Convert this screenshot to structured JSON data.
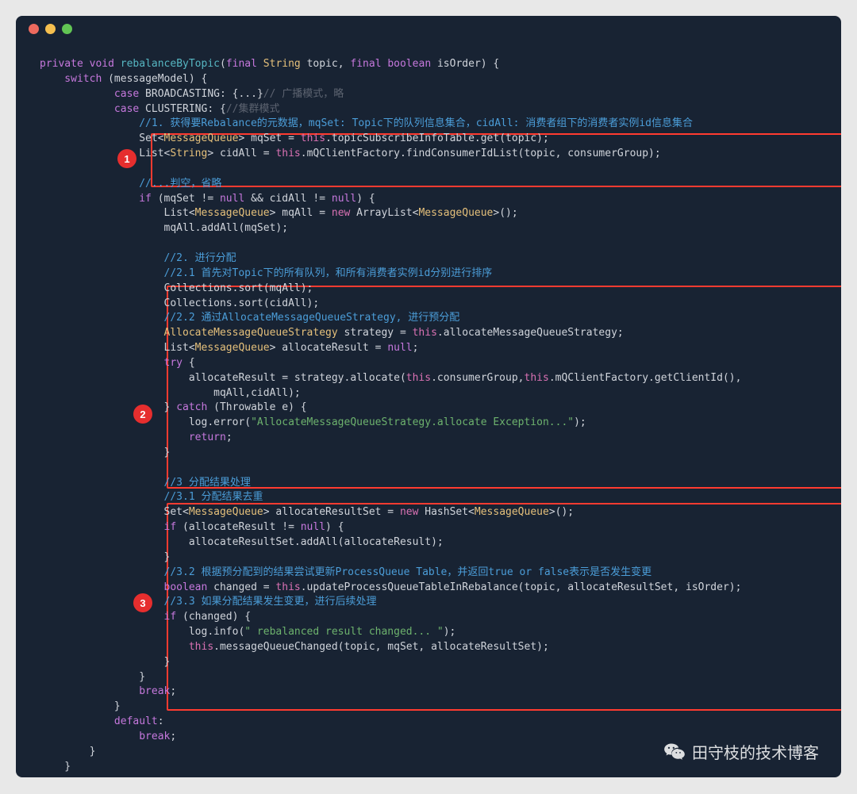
{
  "titlebar": {
    "dots": [
      "red",
      "yellow",
      "green"
    ]
  },
  "badges": [
    "1",
    "2",
    "3"
  ],
  "watermark": "田守枝的技术博客",
  "code": {
    "l01_private": "private",
    "l01_void": "void",
    "l01_fn": "rebalanceByTopic",
    "l01_p1": "(",
    "l01_final1": "final",
    "l01_type1": "String",
    "l01_arg1": " topic, ",
    "l01_final2": "final",
    "l01_boolean": "boolean",
    "l01_arg2": " isOrder) {",
    "l02_switch": "    switch",
    "l02_rest": " (messageModel) {",
    "l03_case": "            case",
    "l03_broad": " BROADCASTING: {...}",
    "l03_cmt": "// 广播模式，略",
    "l04_case": "            case",
    "l04_clust": " CLUSTERING: {",
    "l04_cmt": "//集群模式",
    "l05_cmt": "                //1. 获得要Rebalance的元数据，mqSet: Topic下的队列信息集合，cidAll: 消费者组下的消费者实例id信息集合",
    "l06_set": "                Set<",
    "l06_mq": "MessageQueue",
    "l06_var": "> mqSet = ",
    "l06_this": "this",
    "l06_rest": ".topicSubscribeInfoTable.get(topic);",
    "l07_list": "                List<",
    "l07_str": "String",
    "l07_var": "> cidAll = ",
    "l07_this": "this",
    "l07_rest": ".mQClientFactory.findConsumerIdList(topic, consumerGroup);",
    "l08": "",
    "l09_cmt": "                //...判空，省略",
    "l10_if": "                if",
    "l10_rest": " (mqSet != ",
    "l10_null1": "null",
    "l10_and": " && cidAll != ",
    "l10_null2": "null",
    "l10_brace": ") {",
    "l11_list": "                    List<",
    "l11_mq": "MessageQueue",
    "l11_var": "> mqAll = ",
    "l11_new": "new",
    "l11_al": " ArrayList<",
    "l11_mq2": "MessageQueue",
    "l11_rest": ">();",
    "l12": "                    mqAll.addAll(mqSet);",
    "l13": "",
    "l14_cmt": "                    //2. 进行分配",
    "l15_cmt": "                    //2.1 首先对Topic下的所有队列，和所有消费者实例id分别进行排序",
    "l16": "                    Collections.sort(mqAll);",
    "l17": "                    Collections.sort(cidAll);",
    "l18_cmt": "                    //2.2 通过AllocateMessageQueueStrategy, 进行预分配",
    "l19_type": "                    AllocateMessageQueueStrategy",
    "l19_var": " strategy = ",
    "l19_this": "this",
    "l19_rest": ".allocateMessageQueueStrategy;",
    "l20_list": "                    List<",
    "l20_mq": "MessageQueue",
    "l20_var": "> allocateResult = ",
    "l20_null": "null",
    "l20_semi": ";",
    "l21_try": "                    try",
    "l21_brace": " {",
    "l22_pre": "                        allocateResult = strategy.allocate(",
    "l22_this1": "this",
    "l22_cg": ".consumerGroup,",
    "l22_this2": "this",
    "l22_rest": ".mQClientFactory.getClientId(),",
    "l23": "                            mqAll,cidAll);",
    "l24_rb": "                    } ",
    "l24_catch": "catch",
    "l24_rest": " (Throwable e) {",
    "l25_pre": "                        log.error(",
    "l25_str": "\"AllocateMessageQueueStrategy.allocate Exception...\"",
    "l25_post": ");",
    "l26_ret": "                        return",
    "l26_semi": ";",
    "l27": "                    }",
    "l28": "",
    "l29_cmt": "                    //3 分配结果处理",
    "l30_cmt": "                    //3.1 分配结果去重",
    "l31_set": "                    Set<",
    "l31_mq": "MessageQueue",
    "l31_var": "> allocateResultSet = ",
    "l31_new": "new",
    "l31_hs": " HashSet<",
    "l31_mq2": "MessageQueue",
    "l31_rest": ">();",
    "l32_if": "                    if",
    "l32_rest": " (allocateResult != ",
    "l32_null": "null",
    "l32_brace": ") {",
    "l33": "                        allocateResultSet.addAll(allocateResult);",
    "l34": "                    }",
    "l35_cmt": "                    //3.2 根据预分配到的结果尝试更新ProcessQueue Table，并返回true or false表示是否发生变更",
    "l36_bool": "                    boolean",
    "l36_var": " changed = ",
    "l36_this": "this",
    "l36_rest": ".updateProcessQueueTableInRebalance(topic, allocateResultSet, isOrder);",
    "l37_cmt": "                    //3.3 如果分配结果发生变更，进行后续处理",
    "l38_if": "                    if",
    "l38_rest": " (changed) {",
    "l39_pre": "                        log.info(",
    "l39_str": "\" rebalanced result changed... \"",
    "l39_post": ");",
    "l40_pre": "                        ",
    "l40_this": "this",
    "l40_rest": ".messageQueueChanged(topic, mqSet, allocateResultSet);",
    "l41": "                    }",
    "l42": "                }",
    "l43_br": "                break",
    "l43_semi": ";",
    "l44": "            }",
    "l45_def": "            default",
    "l45_colon": ":",
    "l46_br": "                break",
    "l46_semi": ";",
    "l47": "        }",
    "l48": "    }"
  }
}
